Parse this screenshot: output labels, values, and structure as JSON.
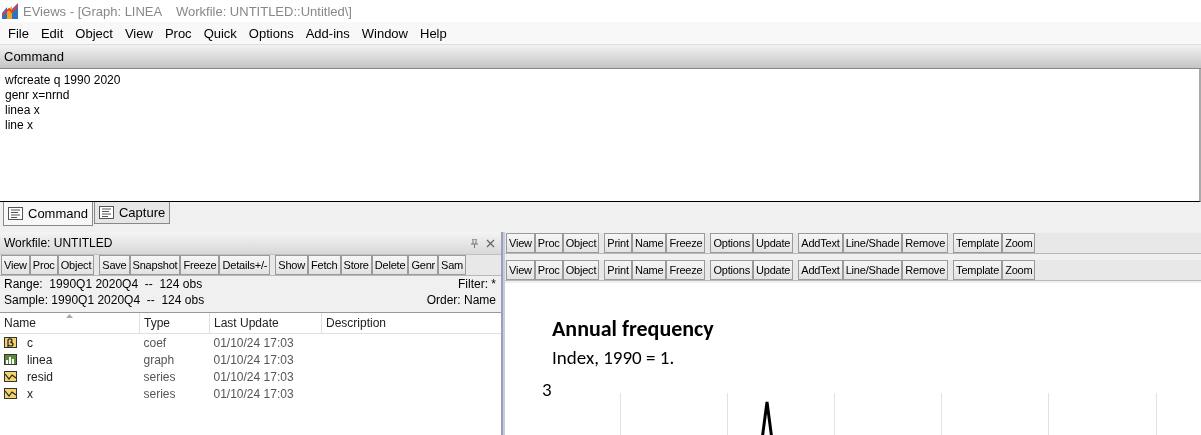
{
  "window": {
    "title": "EViews - [Graph: LINEA    Workfile: UNTITLED::Untitled\\]"
  },
  "menu": [
    "File",
    "Edit",
    "Object",
    "View",
    "Proc",
    "Quick",
    "Options",
    "Add-ins",
    "Window",
    "Help"
  ],
  "command": {
    "header": "Command",
    "lines": [
      "wfcreate q 1990 2020",
      "genr x=nrnd",
      "linea x",
      "line x"
    ]
  },
  "tabs": [
    {
      "label": "Command",
      "selected": true
    },
    {
      "label": "Capture",
      "selected": false
    }
  ],
  "workfile": {
    "title": "Workfile: UNTITLED",
    "toolbar": [
      [
        "View",
        "Proc",
        "Object"
      ],
      [
        "Save",
        "Snapshot",
        "Freeze",
        "Details+/-"
      ],
      [
        "Show",
        "Fetch",
        "Store",
        "Delete",
        "Genr",
        "Sam"
      ]
    ],
    "range": "Range:  1990Q1 2020Q4  --  124 obs",
    "filter": "Filter: *",
    "sample": "Sample: 1990Q1 2020Q4  --  124 obs",
    "order": "Order: Name",
    "columns": [
      "Name",
      "Type",
      "Last Update",
      "Description"
    ],
    "rows": [
      {
        "kind": "coef",
        "name": "c",
        "type": "coef",
        "updated": "01/10/24  17:03"
      },
      {
        "kind": "graph",
        "name": "linea",
        "type": "graph",
        "updated": "01/10/24  17:03"
      },
      {
        "kind": "series",
        "name": "resid",
        "type": "series",
        "updated": "01/10/24  17:03"
      },
      {
        "kind": "series",
        "name": "x",
        "type": "series",
        "updated": "01/10/24  17:03"
      }
    ]
  },
  "graph_toolbars": [
    [
      [
        "View",
        "Proc",
        "Object"
      ],
      [
        "Print",
        "Name",
        "Freeze"
      ],
      [
        "Options",
        "Update"
      ],
      [
        "AddText",
        "Line/Shade",
        "Remove"
      ],
      [
        "Template",
        "Zoom"
      ]
    ],
    [
      [
        "View",
        "Proc",
        "Object"
      ],
      [
        "Print",
        "Name",
        "Freeze"
      ],
      [
        "Options",
        "Update"
      ],
      [
        "AddText",
        "Line/Shade",
        "Remove"
      ],
      [
        "Template",
        "Zoom"
      ]
    ]
  ],
  "graph": {
    "title": "Annual frequency",
    "subtitle": "Index, 1990 = 1.",
    "y_tick_label": "3"
  }
}
